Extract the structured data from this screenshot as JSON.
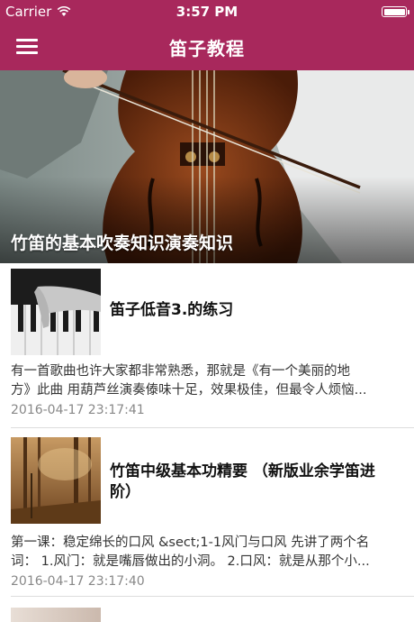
{
  "status_bar": {
    "carrier": "Carrier",
    "time": "3:57 PM"
  },
  "nav": {
    "title": "笛子教程"
  },
  "hero": {
    "caption": "竹笛的基本吹奏知识演奏知识"
  },
  "articles": [
    {
      "title": "笛子低音3.的练习",
      "summary_line1": "有一首歌曲也许大家都非常熟悉，那就是《有一个美丽的地",
      "summary_line2": "方》此曲 用葫芦丝演奏傣味十足，效果极佳，但最令人烦恼...",
      "date": "2016-04-17 23:17:41"
    },
    {
      "title_line1": "竹笛中级基本功精要 （新版业余学笛进",
      "title_line2": "阶）",
      "summary_line1": "第一课：稳定绵长的口风 &sect;1-1风门与口风 先讲了两个名",
      "summary_line2": "词： 1.风门：就是嘴唇做出的小洞。 2.口风：就是从那个小...",
      "date": "2016-04-17 23:17:40"
    }
  ]
}
